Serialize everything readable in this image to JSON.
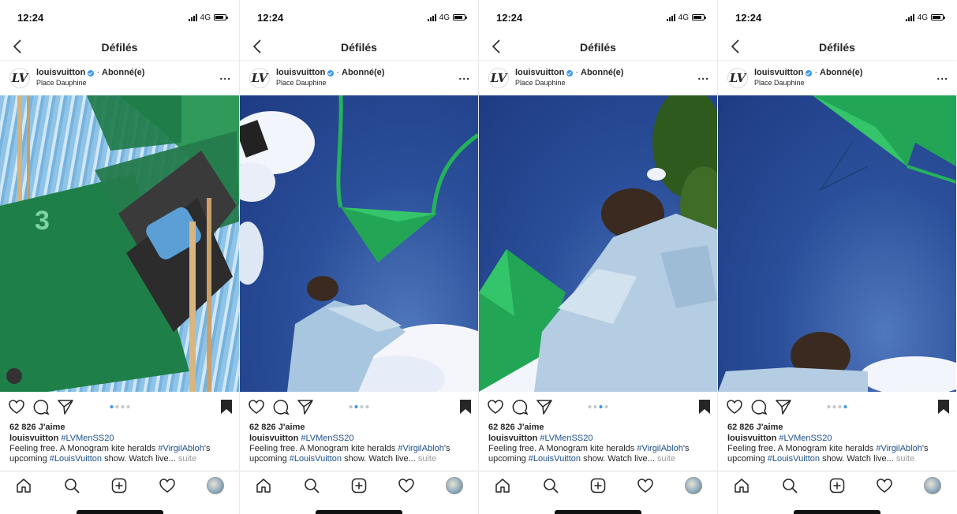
{
  "status": {
    "time": "12:24",
    "network": "4G"
  },
  "nav": {
    "title": "Défilés"
  },
  "post": {
    "username": "louisvuitton",
    "separator": "·",
    "follow_state": "Abonné(e)",
    "location": "Place Dauphine",
    "more": "...",
    "likes": "62 826 J'aime",
    "caption_tag": "#LVMenSS20",
    "caption_part1": "Feeling free. A Monogram kite heralds ",
    "caption_tag2": "#VirgilAbloh",
    "caption_part2": "'s upcoming ",
    "caption_tag3": "#LouisVuitton",
    "caption_part3": " show. Watch live... ",
    "suite": "suite"
  },
  "screens": [
    {
      "photo": "invitation",
      "active_dot": 0
    },
    {
      "photo": "kite-sky",
      "active_dot": 1
    },
    {
      "photo": "model-kite",
      "active_dot": 2
    },
    {
      "photo": "kite-closeup",
      "active_dot": 3
    }
  ],
  "colors": {
    "green": "#1f8a4c",
    "sky": "#2b4f9a",
    "link": "#1a4f8b",
    "verified": "#3897f0"
  },
  "icons": [
    "chevron-left-icon",
    "verified-badge-icon",
    "heart-icon",
    "comment-icon",
    "share-icon",
    "bookmark-icon",
    "home-icon",
    "search-icon",
    "add-post-icon",
    "activity-heart-icon"
  ]
}
